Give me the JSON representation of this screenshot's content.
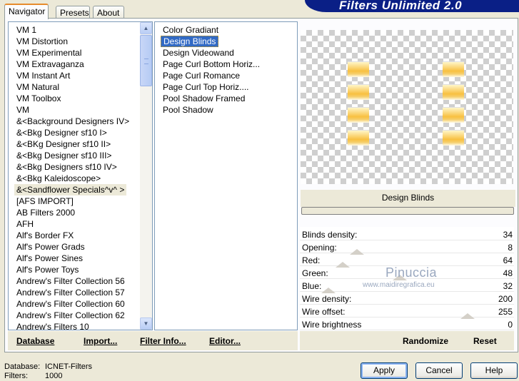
{
  "tabs": [
    "Navigator",
    "Presets",
    "About"
  ],
  "banner": "Filters Unlimited 2.0",
  "categories": [
    "VM 1",
    "VM Distortion",
    "VM Experimental",
    "VM Extravaganza",
    "VM Instant Art",
    "VM Natural",
    "VM Toolbox",
    "VM",
    "&<Background Designers IV>",
    "&<Bkg Designer sf10 I>",
    "&<BKg Designer sf10 II>",
    "&<Bkg Designer sf10 III>",
    "&<Bkg Designers sf10 IV>",
    "&<Bkg Kaleidoscope>",
    "&<Sandflower Specials^v^ >",
    "[AFS IMPORT]",
    "AB Filters 2000",
    "AFH",
    "Alf's Border FX",
    "Alf's Power Grads",
    "Alf's Power Sines",
    "Alf's Power Toys",
    "Andrew's Filter Collection 56",
    "Andrew's Filter Collection 57",
    "Andrew's Filter Collection 60",
    "Andrew's Filter Collection 62",
    "Andrew's Filters 10"
  ],
  "selected_category": "&<Sandflower Specials^v^ >",
  "filters": [
    "Color Gradiant",
    "Design Blinds",
    "Design Videowand",
    "Page Curl Bottom Horiz...",
    "Page Curl Romance",
    "Page Curl Top Horiz....",
    "Pool Shadow Framed",
    "Pool Shadow"
  ],
  "selected_filter": "Design Blinds",
  "left_actions": {
    "database": "Database",
    "import": "Import...",
    "filter_info": "Filter Info...",
    "editor": "Editor..."
  },
  "preview_title": "Design Blinds",
  "params": [
    {
      "label": "Blinds density:",
      "value": "34"
    },
    {
      "label": "Opening:",
      "value": "8"
    },
    {
      "label": "Red:",
      "value": "64"
    },
    {
      "label": "Green:",
      "value": "48"
    },
    {
      "label": "Blue:",
      "value": "32"
    },
    {
      "label": "Wire density:",
      "value": "200"
    },
    {
      "label": "Wire offset:",
      "value": "255"
    },
    {
      "label": "Wire brightness",
      "value": "0"
    }
  ],
  "watermark": {
    "title": "Pinuccia",
    "url": "www.maidiregrafica.eu"
  },
  "right_actions": {
    "randomize": "Randomize",
    "reset": "Reset"
  },
  "status": {
    "database_label": "Database:",
    "database_value": "ICNET-Filters",
    "filters_label": "Filters:",
    "filters_value": "1000"
  },
  "buttons": {
    "apply": "Apply",
    "cancel": "Cancel",
    "help": "Help"
  }
}
